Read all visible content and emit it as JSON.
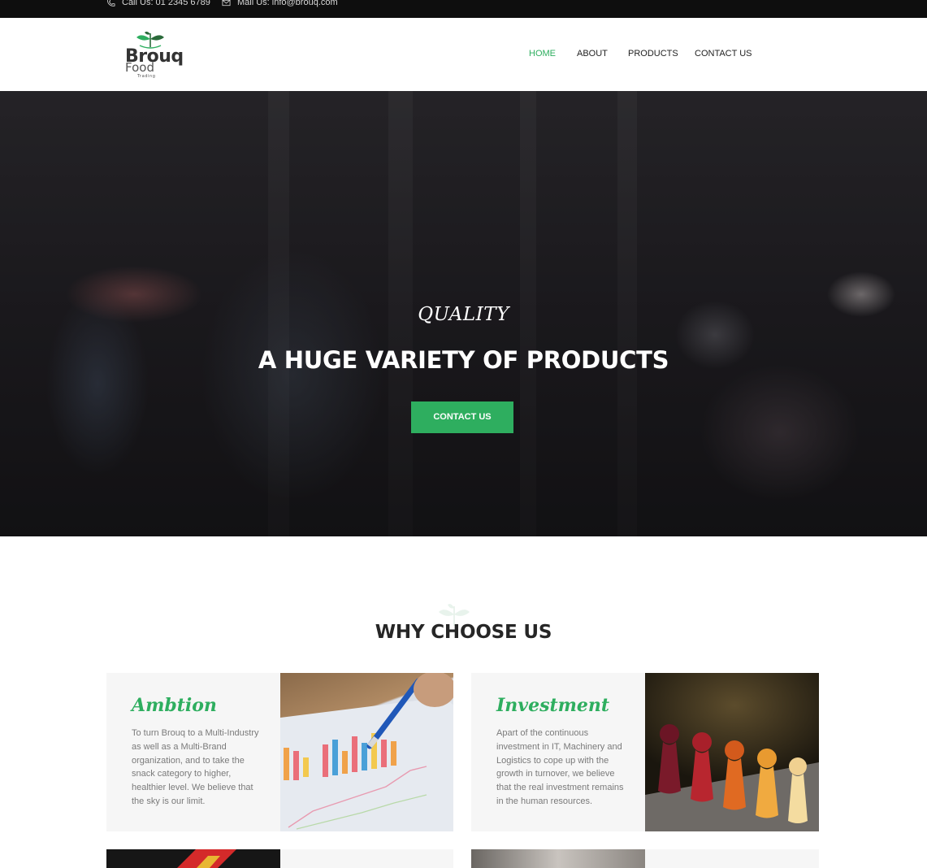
{
  "topbar": {
    "phone_icon": "phone-icon",
    "phone_text": "Call Us: 01 2345 6789",
    "mail_icon": "mail-icon",
    "mail_text": "Mail Us: info@brouq.com"
  },
  "header": {
    "logo": {
      "brand": "Brouq",
      "sub": "Food",
      "tag": "Trading"
    },
    "nav": [
      {
        "label": "HOME",
        "active": true
      },
      {
        "label": "ABOUT",
        "active": false
      },
      {
        "label": "PRODUCTS",
        "active": false
      },
      {
        "label": "CONTACT US",
        "active": false
      }
    ]
  },
  "hero": {
    "subtitle": "QUALITY",
    "title": "A HUGE VARIETY OF PRODUCTS",
    "button": "CONTACT US"
  },
  "why": {
    "title": "WHY CHOOSE US",
    "cards": [
      {
        "title": "Ambtion",
        "text": "To turn Brouq to a Multi-Industry as well as a Multi-Brand organization, and to take the snack category to higher, healthier level. We believe that the sky is our limit."
      },
      {
        "title": "Investment",
        "text": "Apart of the continuous investment in IT, Machinery and Logistics to cope up with the growth in turnover, we believe that the real investment remains in the human resources."
      }
    ]
  },
  "colors": {
    "accent": "#2eae5f",
    "topbar": "#0e0e0e",
    "heading": "#262626"
  }
}
